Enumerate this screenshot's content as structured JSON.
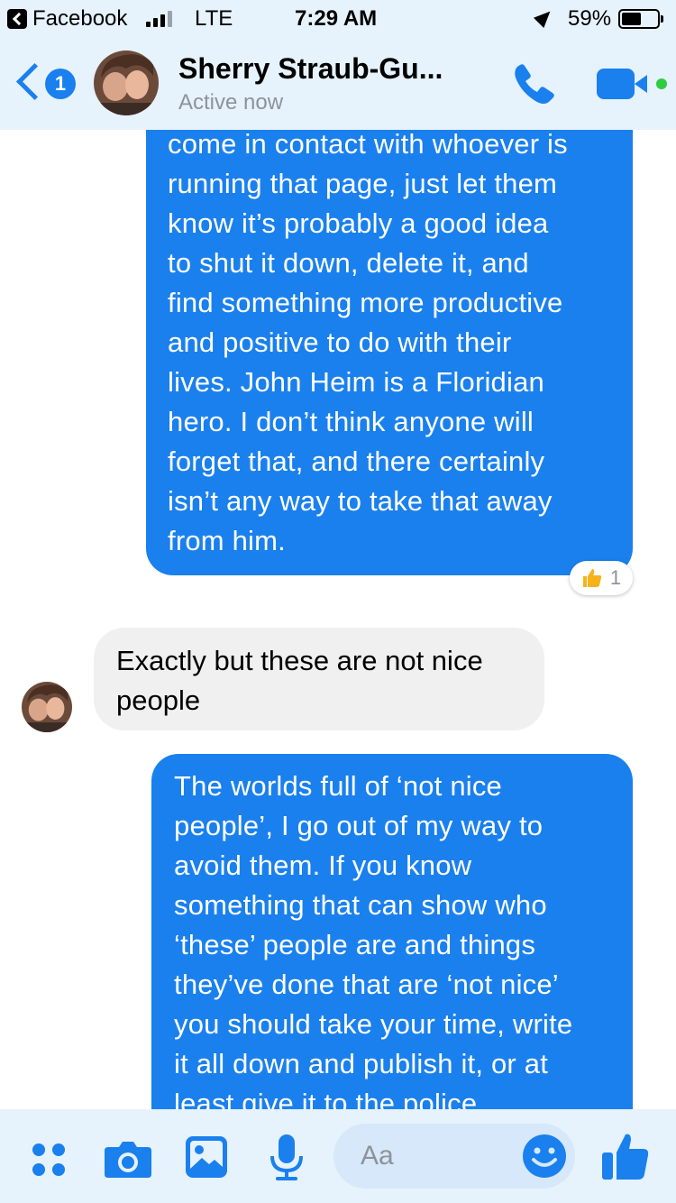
{
  "status_bar": {
    "back_app": "Facebook",
    "network": "LTE",
    "time": "7:29 AM",
    "battery_percent": "59%",
    "battery_level": 0.59,
    "signal_bars_filled": 3,
    "signal_bars_total": 4
  },
  "header": {
    "unread_count": "1",
    "contact_name": "Sherry Straub-Gu...",
    "presence": "Active now",
    "icons": [
      "back-chevron-icon",
      "phone-icon",
      "video-camera-icon"
    ]
  },
  "messages": [
    {
      "sender": "me",
      "lines": [
        "come in contact with whoever is",
        "running that page, just let them",
        "know it’s probably a good idea",
        "to shut it down, delete it, and",
        "find something more productive",
        "and positive to do with their",
        "lives. John Heim is a Floridian",
        "hero. I don’t think anyone will",
        "forget that, and there certainly",
        "isn’t any way to take that away",
        "from him."
      ],
      "reaction": {
        "icon": "thumbs-up-icon",
        "count": "1"
      }
    },
    {
      "sender": "contact",
      "lines": [
        "Exactly but these are not nice",
        "people"
      ]
    },
    {
      "sender": "me",
      "lines": [
        "The worlds full of ‘not nice",
        "people’, I go out of my way to",
        "avoid them. If you know",
        "something that can show who",
        "‘these’ people are and things",
        "they’ve done that are ‘not nice’",
        "you should take your time, write",
        "it all down and publish it, or at",
        "least give it to the police"
      ]
    }
  ],
  "composer": {
    "placeholder": "Aa",
    "icons": [
      "more-apps-icon",
      "camera-icon",
      "photo-gallery-icon",
      "microphone-icon",
      "emoji-icon",
      "thumbs-up-icon"
    ]
  },
  "colors": {
    "accent": "#1a80ee",
    "bar_background": "#e6f2fc",
    "incoming_bubble": "#f0f0f0",
    "presence_text": "#8e9399"
  }
}
